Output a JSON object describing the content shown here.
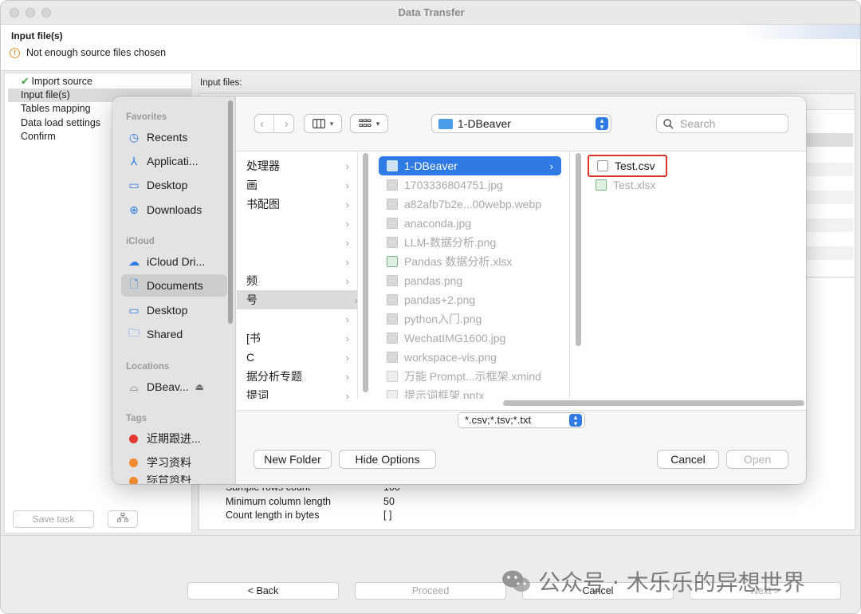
{
  "window": {
    "title": "Data Transfer"
  },
  "header": {
    "title": "Input file(s)",
    "warning": "Not enough source files chosen"
  },
  "sidebar": {
    "steps": [
      {
        "label": "Import source",
        "done": true
      },
      {
        "label": "Input file(s)",
        "selected": true
      },
      {
        "label": "Tables mapping"
      },
      {
        "label": "Data load settings"
      },
      {
        "label": "Confirm"
      }
    ],
    "save_task": "Save task"
  },
  "content": {
    "input_files_label": "Input files:",
    "settings": [
      {
        "label": "Sample rows count",
        "value": "100"
      },
      {
        "label": "Minimum column length",
        "value": "50"
      },
      {
        "label": "Count length in bytes",
        "value": "[ ]"
      }
    ]
  },
  "footer": {
    "back": "< Back",
    "proceed": "Proceed",
    "cancel": "Cancel",
    "next": "Next >"
  },
  "dialog": {
    "sidebar": {
      "favorites_head": "Favorites",
      "favorites": [
        "Recents",
        "Applicati...",
        "Desktop",
        "Downloads"
      ],
      "icloud_head": "iCloud",
      "icloud": [
        "iCloud Dri...",
        "Documents",
        "Desktop",
        "Shared"
      ],
      "locations_head": "Locations",
      "locations": [
        "DBeav..."
      ],
      "tags_head": "Tags",
      "tags": [
        {
          "label": "近期跟进...",
          "color": "#e53935"
        },
        {
          "label": "学习资料",
          "color": "#f0892f"
        },
        {
          "label": "综合资料",
          "color": "#f0892f"
        }
      ]
    },
    "path": "1-DBeaver",
    "search_placeholder": "Search",
    "column1": [
      "处理器",
      "画",
      "书配图",
      "",
      "",
      "",
      "频",
      "号",
      "",
      "[书",
      "C",
      "据分析专题",
      "提词"
    ],
    "column2": [
      {
        "name": "1-DBeaver",
        "kind": "folder"
      },
      {
        "name": "1703336804751.jpg",
        "kind": "img"
      },
      {
        "name": "a82afb7b2e...00webp.webp",
        "kind": "img"
      },
      {
        "name": "anaconda.jpg",
        "kind": "img"
      },
      {
        "name": "LLM-数据分析.png",
        "kind": "img"
      },
      {
        "name": "Pandas 数据分析.xlsx",
        "kind": "xlsx"
      },
      {
        "name": "pandas.png",
        "kind": "img"
      },
      {
        "name": "pandas+2.png",
        "kind": "img"
      },
      {
        "name": "python入门.png",
        "kind": "img"
      },
      {
        "name": "WechatIMG1600.jpg",
        "kind": "img"
      },
      {
        "name": "workspace-vis.png",
        "kind": "img"
      },
      {
        "name": "万能 Prompt...示框架.xmind",
        "kind": "doc"
      },
      {
        "name": "提示词框架.pptx",
        "kind": "doc"
      }
    ],
    "column3": [
      {
        "name": "Test.csv",
        "kind": "csv"
      },
      {
        "name": "Test.xlsx",
        "kind": "xlsx"
      }
    ],
    "filter": "*.csv;*.tsv;*.txt",
    "buttons": {
      "new_folder": "New Folder",
      "hide_options": "Hide Options",
      "cancel": "Cancel",
      "open": "Open"
    }
  },
  "watermark": "公众号 · 木乐乐的异想世界"
}
